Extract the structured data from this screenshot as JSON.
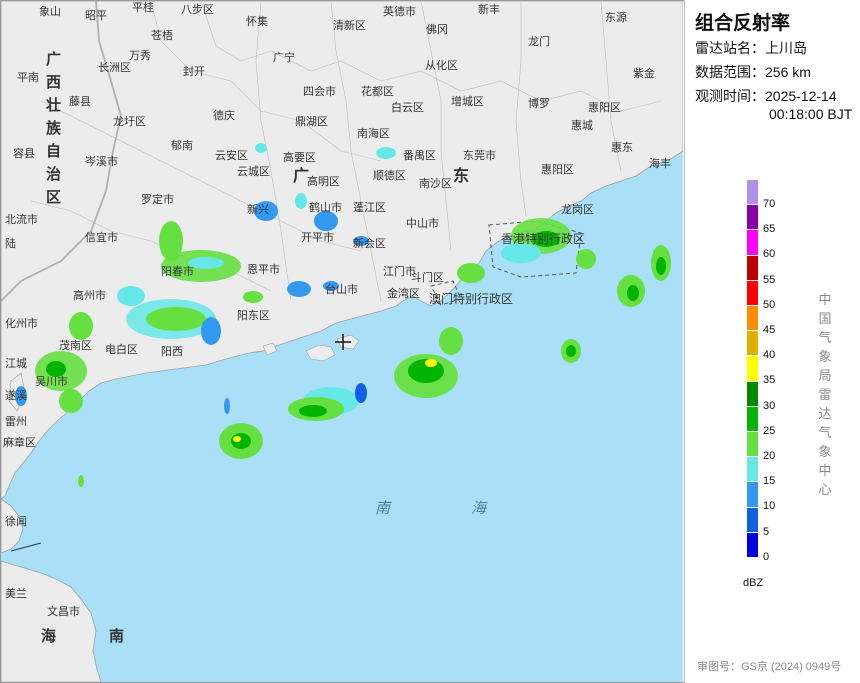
{
  "panel": {
    "title": "组合反射率",
    "station_label": "雷达站名：",
    "station_value": "上川岛",
    "range_label": "数据范围：",
    "range_value": "256 km",
    "time_label": "观测时间：",
    "time_date": "2025-12-14",
    "time_clock": "00:18:00 BJT",
    "unit": "dBZ",
    "vertical_text": [
      "中",
      "国",
      "气",
      "象",
      "局",
      "雷",
      "达",
      "气",
      "象",
      "中",
      "心"
    ],
    "approval": "审图号：GS京 (2024) 0949号"
  },
  "legend": [
    {
      "value": "70",
      "color": "#b090e8"
    },
    {
      "value": "65",
      "color": "#8a00a8"
    },
    {
      "value": "60",
      "color": "#ff00ff"
    },
    {
      "value": "55",
      "color": "#c00000"
    },
    {
      "value": "50",
      "color": "#ff0000"
    },
    {
      "value": "45",
      "color": "#ff8c00"
    },
    {
      "value": "40",
      "color": "#e0b000"
    },
    {
      "value": "35",
      "color": "#ffff00"
    },
    {
      "value": "30",
      "color": "#008a00"
    },
    {
      "value": "25",
      "color": "#00b400"
    },
    {
      "value": "20",
      "color": "#66e040"
    },
    {
      "value": "15",
      "color": "#66e8e8"
    },
    {
      "value": "10",
      "color": "#3399ee"
    },
    {
      "value": "5",
      "color": "#1060e0"
    },
    {
      "value": "0",
      "color": "#0000e0"
    }
  ],
  "map_labels": {
    "cities": [
      "象山",
      "昭平",
      "平桂",
      "八步区",
      "怀集",
      "清新区",
      "英德市",
      "新丰",
      "东源",
      "苍梧",
      "广宁",
      "佛冈",
      "龙门",
      "长洲区",
      "万秀",
      "封开",
      "从化区",
      "紫金",
      "平南",
      "藤县",
      "四会市",
      "花都区",
      "增城区",
      "博罗",
      "惠阳区",
      "龙圩区",
      "德庆",
      "鼎湖区",
      "南海区",
      "白云区",
      "惠城",
      "容县",
      "岑溪市",
      "郁南",
      "云安区",
      "高要区",
      "番禺区",
      "东莞市",
      "惠东",
      "海丰",
      "北流市",
      "罗定市",
      "云城区",
      "高明区",
      "顺德区",
      "南沙区",
      "惠阳区",
      "龙岗区",
      "陆",
      "信宜市",
      "新兴",
      "鹤山市",
      "蓬江区",
      "中山市",
      "开平市",
      "新会区",
      "阳春市",
      "恩平市",
      "江门市",
      "高州市",
      "斗门区",
      "金湾区",
      "化州市",
      "阳东区",
      "台山市",
      "茂南区",
      "电白区",
      "阳西",
      "江城",
      "吴川市",
      "麻章区",
      "遂溪",
      "雷州",
      "徐闻",
      "文昌市",
      "美兰"
    ],
    "provinces": [
      "广",
      "东",
      "广西壮族自治区",
      "海",
      "南",
      "南",
      "海"
    ],
    "hk": "香港特别行政区",
    "macau": "澳门特别行政区"
  }
}
